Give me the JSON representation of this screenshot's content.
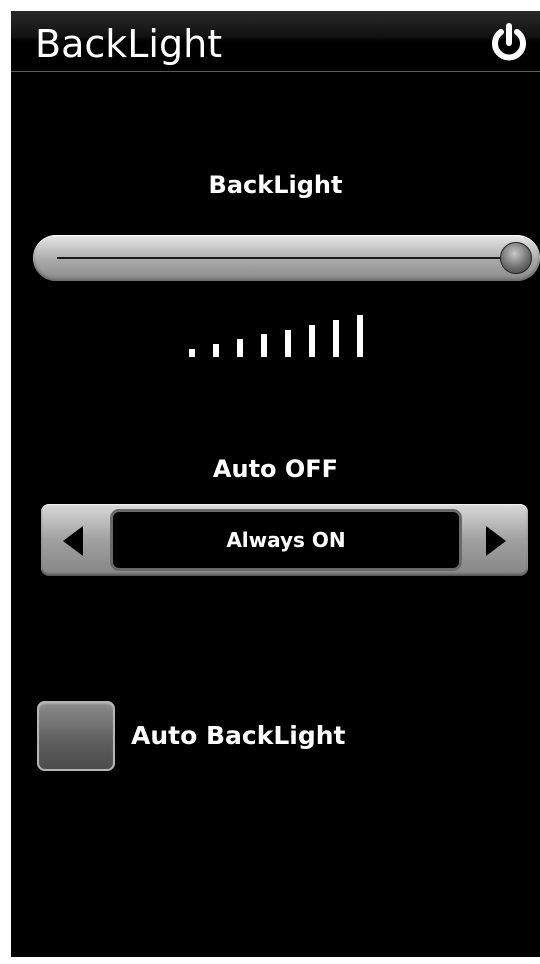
{
  "header": {
    "title": "BackLight",
    "power_icon": "power-icon"
  },
  "brightness": {
    "label": "BackLight",
    "level": 8,
    "level_max": 8
  },
  "auto_off": {
    "label": "Auto OFF",
    "value": "Always ON",
    "prev_icon": "triangle-left-icon",
    "next_icon": "triangle-right-icon"
  },
  "auto_backlight": {
    "label": "Auto BackLight",
    "checked": false
  },
  "colors": {
    "background": "#000000",
    "text": "#ffffff",
    "control_gray": "#a0a0a0"
  }
}
